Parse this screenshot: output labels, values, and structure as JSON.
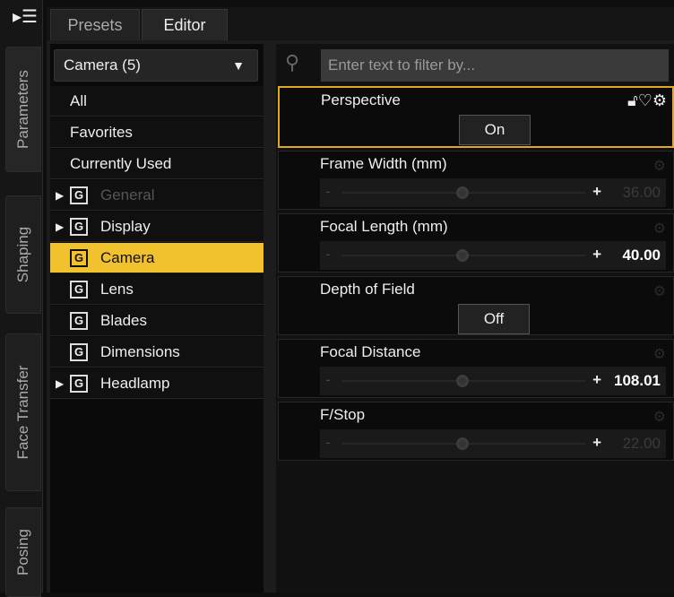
{
  "side_tabs": [
    "Parameters",
    "Shaping",
    "Face Transfer",
    "Posing"
  ],
  "tabs": [
    "Presets",
    "Editor"
  ],
  "dropdown": "Camera (5)",
  "filters": [
    "All",
    "Favorites",
    "Currently Used"
  ],
  "groups": [
    {
      "label": "General",
      "expandable": true,
      "dim": true
    },
    {
      "label": "Display",
      "expandable": true
    },
    {
      "label": "Camera",
      "selected": true
    },
    {
      "label": "Lens"
    },
    {
      "label": "Blades"
    },
    {
      "label": "Dimensions"
    },
    {
      "label": "Headlamp",
      "expandable": true
    }
  ],
  "search_placeholder": "Enter text to filter by...",
  "params": [
    {
      "name": "Perspective",
      "type": "toggle",
      "value": "On"
    },
    {
      "name": "Frame Width (mm)",
      "type": "slider",
      "value": "36.00"
    },
    {
      "name": "Focal Length (mm)",
      "type": "slider",
      "value": "40.00"
    },
    {
      "name": "Depth of Field",
      "type": "toggle",
      "value": "Off"
    },
    {
      "name": "Focal Distance",
      "type": "slider",
      "value": "108.01"
    },
    {
      "name": "F/Stop",
      "type": "slider",
      "value": "22.00"
    }
  ],
  "accent": "#f2c12e"
}
